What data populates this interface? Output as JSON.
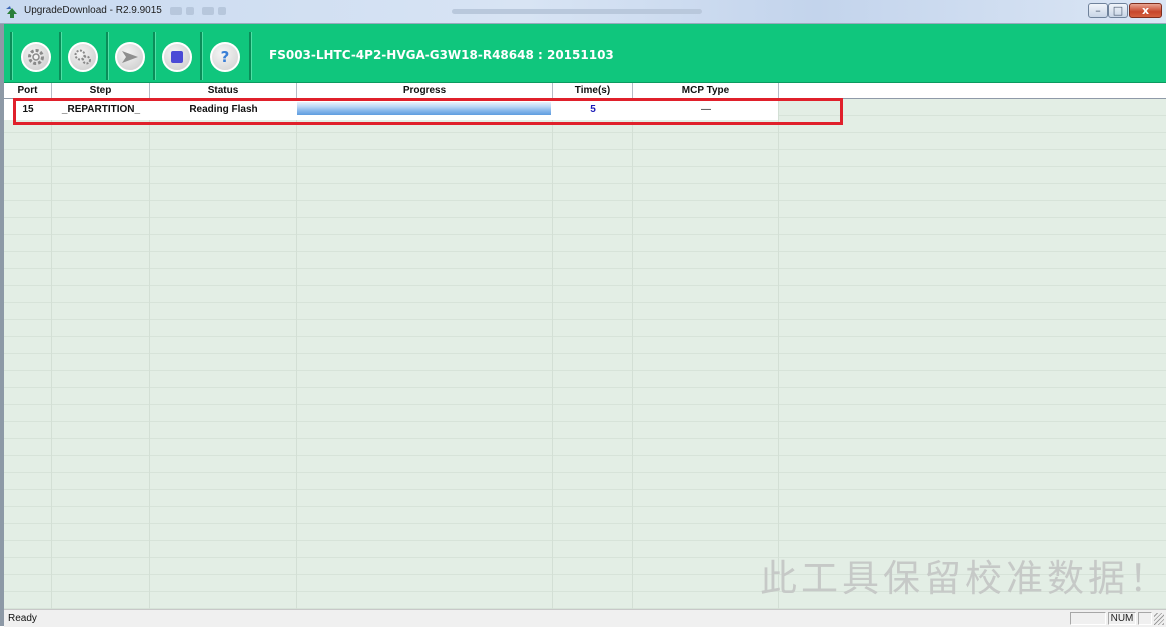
{
  "window": {
    "title": "UpgradeDownload - R2.9.9015",
    "controls": {
      "minimize": "–",
      "maximize": "□",
      "close": "x"
    }
  },
  "toolbar": {
    "firmware_label": "FS003-LHTC-4P2-HVGA-G3W18-R48648 : 20151103",
    "buttons": [
      {
        "name": "settings-icon",
        "symbol": "⚙"
      },
      {
        "name": "advanced-settings-icon",
        "symbol": "⚙"
      },
      {
        "name": "start-icon",
        "symbol": "➤"
      },
      {
        "name": "stop-icon",
        "symbol": "■"
      },
      {
        "name": "help-icon",
        "symbol": "?"
      }
    ]
  },
  "table": {
    "columns": [
      "Port",
      "Step",
      "Status",
      "Progress",
      "Time(s)",
      "MCP Type"
    ],
    "rows": [
      {
        "port": "15",
        "step": "_REPARTITION_",
        "status": "Reading Flash",
        "progress": 1.0,
        "time": "5",
        "mcp_type": "—"
      }
    ]
  },
  "watermark": "此工具保留校准数据！",
  "statusbar": {
    "text": "Ready",
    "num": "NUM"
  },
  "colors": {
    "toolbar": "#10c67d",
    "highlight": "#e0202b",
    "grid_bg": "#e3eee5"
  }
}
